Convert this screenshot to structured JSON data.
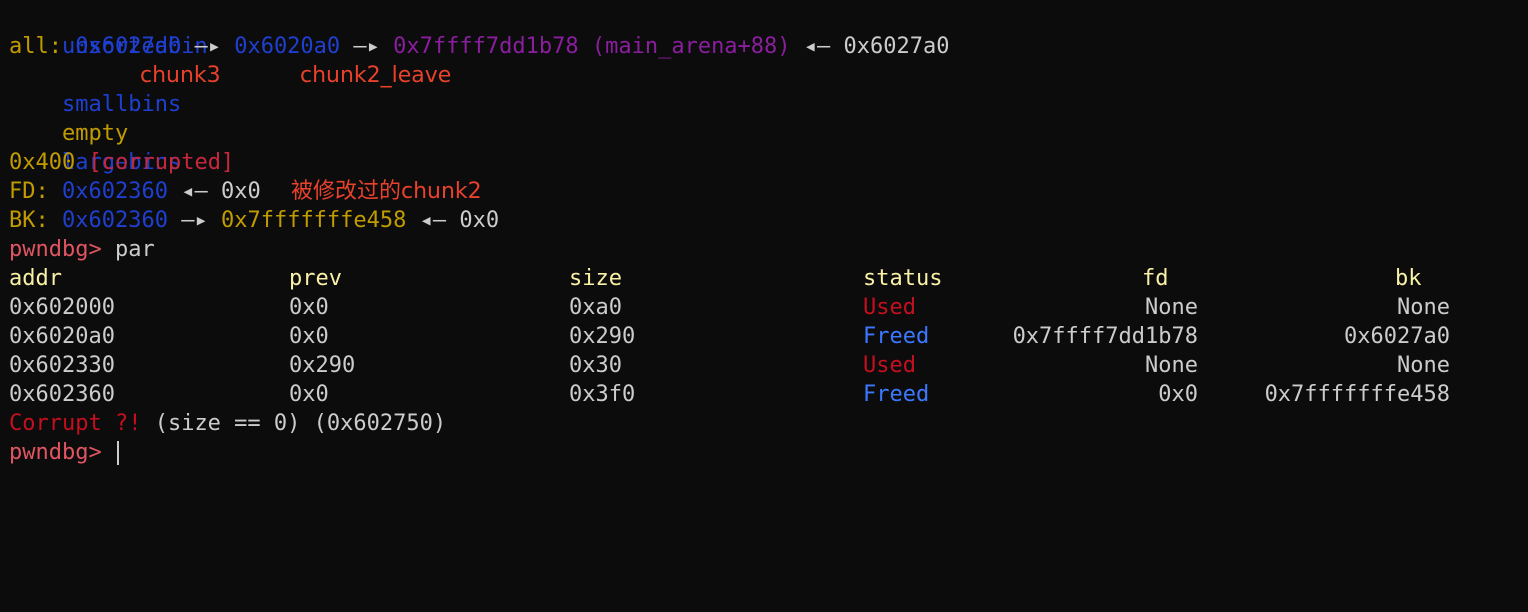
{
  "lines": {
    "unsortedbin": "unsortedbin",
    "all": {
      "label": "all:",
      "a1": "0x6027a0",
      "arrow": "—▸",
      "a2": "0x6020a0",
      "a3": "0x7ffff7dd1b78",
      "a3_sym": "(main_arena+88)",
      "back_arrow": "◂—",
      "a4": "0x6027a0"
    },
    "smallbins": "smallbins",
    "annot_chunk3": "chunk3",
    "annot_chunk2_leave": "chunk2_leave",
    "empty": "empty",
    "largebins": "largebins",
    "size_line": {
      "size": "0x400",
      "flag": "[corrupted]"
    },
    "fd_line": {
      "label": "FD:",
      "addr": "0x602360",
      "arrow": "◂—",
      "val": "0x0",
      "annot": "被修改过的chunk2"
    },
    "bk_line": {
      "label": "BK:",
      "addr": "0x602360",
      "arrow": "—▸",
      "addr2": "0x7fffffffe458",
      "back_arrow": "◂—",
      "val": "0x0"
    },
    "prompt": "pwndbg>",
    "command": "par"
  },
  "table": {
    "headers": [
      "addr",
      "prev",
      "size",
      "status",
      "fd",
      "bk"
    ],
    "rows": [
      {
        "addr": "0x602000",
        "prev": "0x0",
        "size": "0xa0",
        "status": "Used",
        "fd": "None",
        "bk": "None"
      },
      {
        "addr": "0x6020a0",
        "prev": "0x0",
        "size": "0x290",
        "status": "Freed",
        "fd": "0x7ffff7dd1b78",
        "bk": "0x6027a0"
      },
      {
        "addr": "0x602330",
        "prev": "0x290",
        "size": "0x30",
        "status": "Used",
        "fd": "None",
        "bk": "None"
      },
      {
        "addr": "0x602360",
        "prev": "0x0",
        "size": "0x3f0",
        "status": "Freed",
        "fd": "0x0",
        "bk": "0x7fffffffe458"
      }
    ]
  },
  "corrupt": {
    "label": "Corrupt ?!",
    "detail": "(size == 0) (0x602750)"
  },
  "final_prompt": "pwndbg>",
  "colors": {
    "background": "#0c0c0c",
    "blue": "#1f3fd0",
    "yellow": "#c19c00",
    "purple": "#8a1e9e",
    "red": "#c5283d",
    "prompt": "#e05561",
    "header": "#f9f1a5",
    "used": "#c50f1f",
    "freed": "#3b78ff",
    "annotation": "#e8412c"
  }
}
